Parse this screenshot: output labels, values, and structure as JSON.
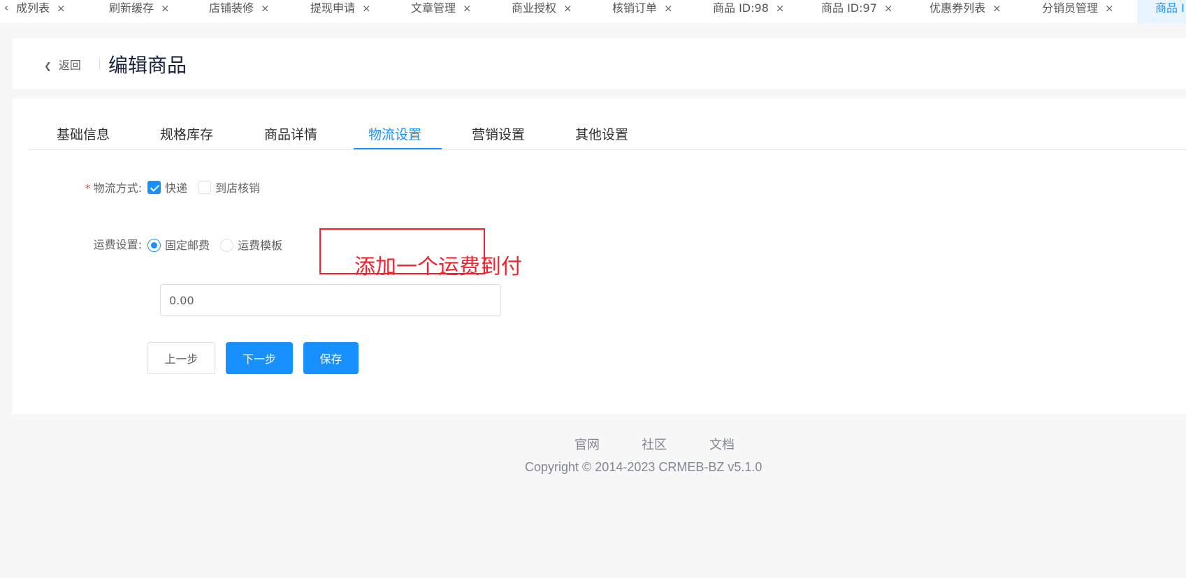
{
  "tagbar": {
    "tabs": [
      {
        "label": "成列表"
      },
      {
        "label": "刷新缓存"
      },
      {
        "label": "店铺装修"
      },
      {
        "label": "提现申请"
      },
      {
        "label": "文章管理"
      },
      {
        "label": "商业授权"
      },
      {
        "label": "核销订单"
      },
      {
        "label": "商品 ID:98"
      },
      {
        "label": "商品 ID:97"
      },
      {
        "label": "优惠券列表"
      },
      {
        "label": "分销员管理"
      },
      {
        "label": "商品 I"
      }
    ],
    "close_glyph": "×",
    "prev_glyph": "‹"
  },
  "header": {
    "back_label": "返回",
    "back_icon": "chevron-left-icon",
    "title": "编辑商品"
  },
  "tabs": {
    "items": [
      "基础信息",
      "规格库存",
      "商品详情",
      "物流设置",
      "营销设置",
      "其他设置"
    ],
    "active_index": 3
  },
  "form": {
    "delivery": {
      "label": "物流方式:",
      "required_mark": "*",
      "options": [
        {
          "label": "快递",
          "checked": true
        },
        {
          "label": "到店核销",
          "checked": false
        }
      ]
    },
    "freight": {
      "label": "运费设置:",
      "options": [
        {
          "label": "固定邮费",
          "selected": true
        },
        {
          "label": "运费模板",
          "selected": false
        }
      ],
      "value": "0.00"
    },
    "buttons": {
      "prev": "上一步",
      "next": "下一步",
      "save": "保存"
    }
  },
  "annotation": {
    "text": "添加一个运费到付",
    "color": "#f5222d"
  },
  "footer": {
    "links": [
      "官网",
      "社区",
      "文档"
    ],
    "copyright": "Copyright © 2014-2023 CRMEB-BZ v5.1.0"
  },
  "colors": {
    "accent": "#1890ff",
    "required": "#ff4d4f"
  }
}
